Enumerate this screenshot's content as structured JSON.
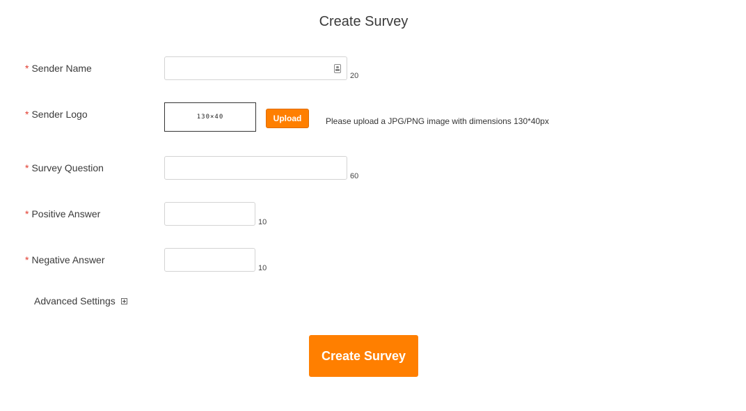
{
  "page": {
    "title": "Create Survey"
  },
  "form": {
    "required_marker": "*",
    "sender_name": {
      "label": "Sender Name",
      "value": "",
      "limit": "20",
      "icon": "contact-card-icon"
    },
    "sender_logo": {
      "label": "Sender Logo",
      "placeholder_text": "130×40",
      "upload_label": "Upload",
      "hint": "Please upload a JPG/PNG image with dimensions 130*40px"
    },
    "survey_question": {
      "label": "Survey Question",
      "value": "",
      "limit": "60"
    },
    "positive_answer": {
      "label": "Positive Answer",
      "value": "",
      "limit": "10"
    },
    "negative_answer": {
      "label": "Negative Answer",
      "value": "",
      "limit": "10"
    },
    "advanced": {
      "label": "Advanced Settings",
      "icon": "plus-square-icon"
    },
    "submit_label": "Create Survey"
  },
  "colors": {
    "accent": "#ff7f00",
    "required": "#e23b2e",
    "border": "#d3d3d3"
  }
}
